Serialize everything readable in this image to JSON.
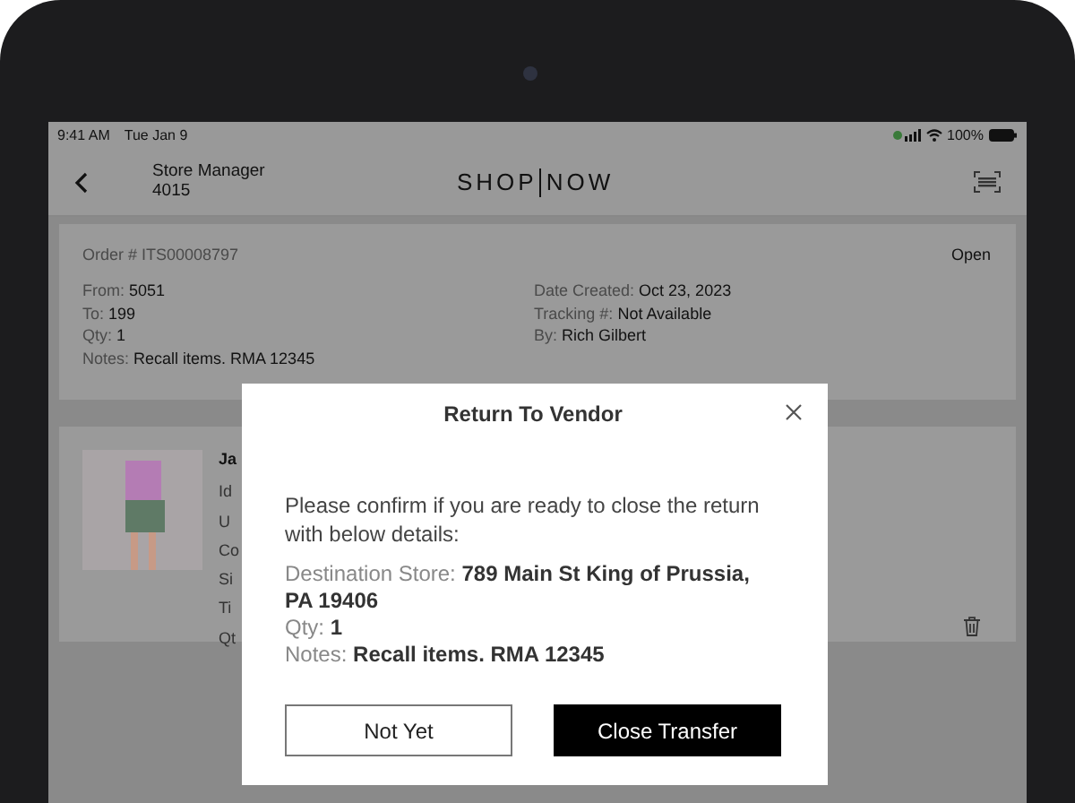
{
  "status_bar": {
    "time": "9:41 AM",
    "date": "Tue Jan 9",
    "battery": "100%"
  },
  "header": {
    "title": "Store Manager",
    "subtitle": "4015",
    "logo_left": "SHOP",
    "logo_right": "NOW"
  },
  "order": {
    "number": "Order # ITS00008797",
    "status": "Open",
    "left_fields": [
      {
        "label": "From:",
        "value": "5051"
      },
      {
        "label": "To:",
        "value": "199"
      },
      {
        "label": "Qty:",
        "value": "1"
      },
      {
        "label": "Notes:",
        "value": "Recall items. RMA 12345"
      }
    ],
    "right_fields": [
      {
        "label": "Date Created:",
        "value": "Oct 23, 2023"
      },
      {
        "label": "Tracking #:",
        "value": "Not Available"
      },
      {
        "label": "By:",
        "value": "Rich Gilbert"
      }
    ]
  },
  "product": {
    "title": "Ja",
    "field_labels": [
      "Id",
      "U",
      "Co",
      "Si",
      "Ti",
      "Qt"
    ]
  },
  "modal": {
    "title": "Return To Vendor",
    "message": "Please confirm if you are ready to close the return with below details:",
    "details": [
      {
        "label": "Destination Store:",
        "value": "789 Main St King of Prussia, PA 19406"
      },
      {
        "label": "Qty:",
        "value": "1"
      },
      {
        "label": "Notes:",
        "value": "Recall items. RMA 12345"
      }
    ],
    "buttons": [
      {
        "label": "Not Yet",
        "kind": "secondary"
      },
      {
        "label": "Close Transfer",
        "kind": "primary"
      }
    ]
  }
}
